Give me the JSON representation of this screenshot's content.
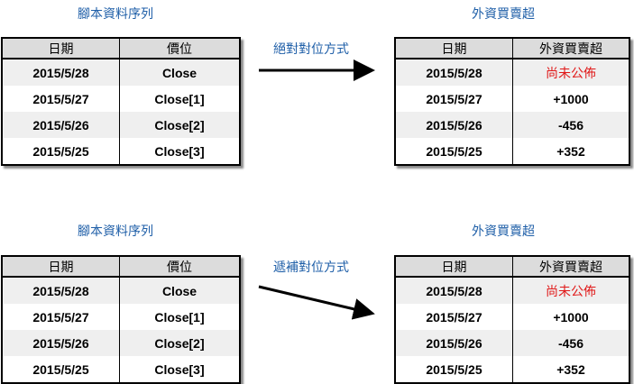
{
  "sections": [
    {
      "left_caption": "腳本資料序列",
      "right_caption": "外資買賣超",
      "method": "絕對對位方式",
      "left_table": {
        "headers": [
          "日期",
          "價位"
        ],
        "rows": [
          [
            "2015/5/28",
            "Close"
          ],
          [
            "2015/5/27",
            "Close[1]"
          ],
          [
            "2015/5/26",
            "Close[2]"
          ],
          [
            "2015/5/25",
            "Close[3]"
          ]
        ]
      },
      "right_table": {
        "headers": [
          "日期",
          "外資買賣超"
        ],
        "rows": [
          [
            "2015/5/28",
            "尚未公佈"
          ],
          [
            "2015/5/27",
            "+1000"
          ],
          [
            "2015/5/26",
            "-456"
          ],
          [
            "2015/5/25",
            "+352"
          ]
        ]
      }
    },
    {
      "left_caption": "腳本資料序列",
      "right_caption": "外資買賣超",
      "method": "遞補對位方式",
      "left_table": {
        "headers": [
          "日期",
          "價位"
        ],
        "rows": [
          [
            "2015/5/28",
            "Close"
          ],
          [
            "2015/5/27",
            "Close[1]"
          ],
          [
            "2015/5/26",
            "Close[2]"
          ],
          [
            "2015/5/25",
            "Close[3]"
          ]
        ]
      },
      "right_table": {
        "headers": [
          "日期",
          "外資買賣超"
        ],
        "rows": [
          [
            "2015/5/28",
            "尚未公佈"
          ],
          [
            "2015/5/27",
            "+1000"
          ],
          [
            "2015/5/26",
            "-456"
          ],
          [
            "2015/5/25",
            "+352"
          ]
        ]
      }
    }
  ],
  "colors": {
    "caption": "#1f5fa8",
    "pending": "#e01818",
    "header_bg": "#dcdcdc",
    "stripe": "#efefef"
  }
}
